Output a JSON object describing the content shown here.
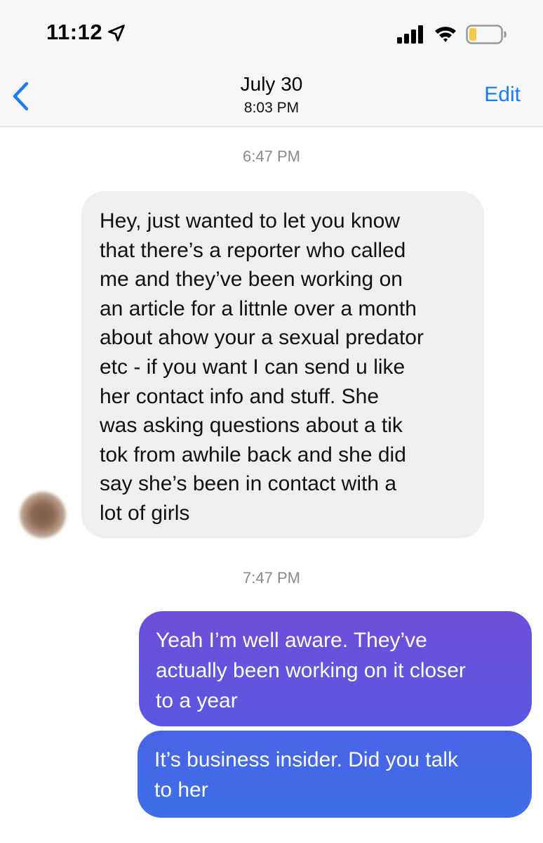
{
  "status_bar": {
    "time": "11:12"
  },
  "nav": {
    "title": "July 30",
    "subtitle": "8:03 PM",
    "edit_label": "Edit"
  },
  "colors": {
    "accent": "#1b7cf4",
    "incoming_bubble": "#efefef",
    "outgoing_bubble_top": "#6f4fd9",
    "outgoing_bubble_bottom": "#3d6fe8",
    "battery_level": "#f7c948"
  },
  "icons": [
    "location-arrow-icon",
    "signal-icon",
    "wifi-icon",
    "battery-icon",
    "back-chevron-icon"
  ],
  "battery_level_fraction": 0.2,
  "messages": [
    {
      "timestamp": "6:47 PM",
      "direction": "incoming",
      "lines": [
        "Hey, just wanted to let you know",
        "that there’s a reporter who called",
        "me and they’ve been working on",
        "an article for a littnle over a month",
        "about ahow your a sexual predator",
        "etc - if you want I can send u like",
        "her contact info and stuff. She",
        "was asking questions about a tik",
        "tok from awhile back and she did",
        "say she’s been in contact with a",
        "lot of girls"
      ]
    },
    {
      "timestamp": "7:47 PM",
      "direction": "outgoing",
      "lines": [
        "Yeah I’m well aware.  They’ve",
        "actually been working on it closer",
        "to a year"
      ]
    },
    {
      "direction": "outgoing",
      "lines": [
        "It’s business insider.   Did you talk",
        "to her"
      ]
    }
  ]
}
